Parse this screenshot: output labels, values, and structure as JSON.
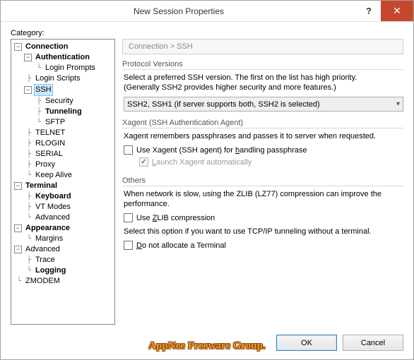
{
  "title": "New Session Properties",
  "category_label": "Category:",
  "breadcrumb": "Connection  >  SSH",
  "tree": {
    "connection": "Connection",
    "authentication": "Authentication",
    "login_prompts": "Login Prompts",
    "login_scripts": "Login Scripts",
    "ssh": "SSH",
    "security": "Security",
    "tunneling": "Tunneling",
    "sftp": "SFTP",
    "telnet": "TELNET",
    "rlogin": "RLOGIN",
    "serial": "SERIAL",
    "proxy": "Proxy",
    "keep_alive": "Keep Alive",
    "terminal": "Terminal",
    "keyboard": "Keyboard",
    "vt_modes": "VT Modes",
    "adv_term": "Advanced",
    "appearance": "Appearance",
    "margins": "Margins",
    "advanced": "Advanced",
    "trace": "Trace",
    "logging": "Logging",
    "zmodem": "ZMODEM"
  },
  "sections": {
    "proto": {
      "title": "Protocol Versions",
      "desc1": "Select a preferred SSH version. The first on the list has high priority.",
      "desc2": "(Generally SSH2 provides higher security and more features.)",
      "select_value": "SSH2, SSH1 (if server supports both, SSH2 is selected)"
    },
    "xagent": {
      "title": "Xagent (SSH Authentication Agent)",
      "desc": "Xagent remembers passphrases and passes it to server when requested.",
      "chk_use_pre": "Use Xagent (SSH agent) for ",
      "chk_use_u": "h",
      "chk_use_post": "andling passphrase",
      "chk_launch_pre": "",
      "chk_launch_u": "L",
      "chk_launch_post": "aunch Xagent automatically"
    },
    "others": {
      "title": "Others",
      "desc1": "When network is slow, using the ZLIB (LZ77) compression can improve the performance.",
      "chk_zlib_pre": "Use ",
      "chk_zlib_u": "Z",
      "chk_zlib_post": "LIB compression",
      "desc2": "Select this option if you want to use TCP/IP tunneling without a terminal.",
      "chk_term_pre": "",
      "chk_term_u": "D",
      "chk_term_post": "o not allocate a Terminal"
    }
  },
  "buttons": {
    "ok": "OK",
    "cancel": "Cancel"
  },
  "watermark": "AppNee Freeware Group."
}
